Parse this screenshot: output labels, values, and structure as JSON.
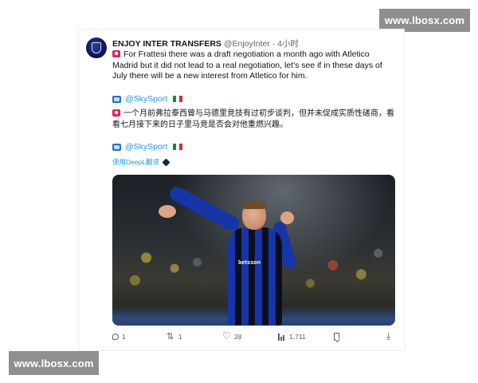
{
  "watermark": {
    "top": "www.lbosx.com",
    "bottom": "www.lbosx.com"
  },
  "tweet": {
    "author": {
      "name": "ENJOY INTER TRANSFERS",
      "handle": "@EnjoyInter",
      "time": "4小时"
    },
    "text_en": "For Frattesi there was a draft negotiation a month ago with Atletico Madrid but it did not lead to a real negotiation, let's see if in these days of July there will be a new interest from Atletico for him.",
    "source_tag_1": "@SkySport",
    "text_zh": "一个月前弗拉泰西曾与马德里竞技有过初步谈判，但并未促成实质性磋商，看看七月接下来的日子里马竞是否会对他重燃兴趣。",
    "source_tag_2": "@SkySport",
    "translate_note": "使用DeepL翻译",
    "photo": {
      "icon": "football-player-photo",
      "sponsor_text": "betsson"
    },
    "actions": {
      "reply": "1",
      "retweet": "1",
      "like": "28",
      "views": "1,711"
    }
  },
  "colors": {
    "link": "#1d9bf0",
    "muted": "#536471",
    "badge": "#e0245e",
    "flag_green": "#009246",
    "flag_white": "#ffffff",
    "flag_red": "#ce2b37"
  }
}
